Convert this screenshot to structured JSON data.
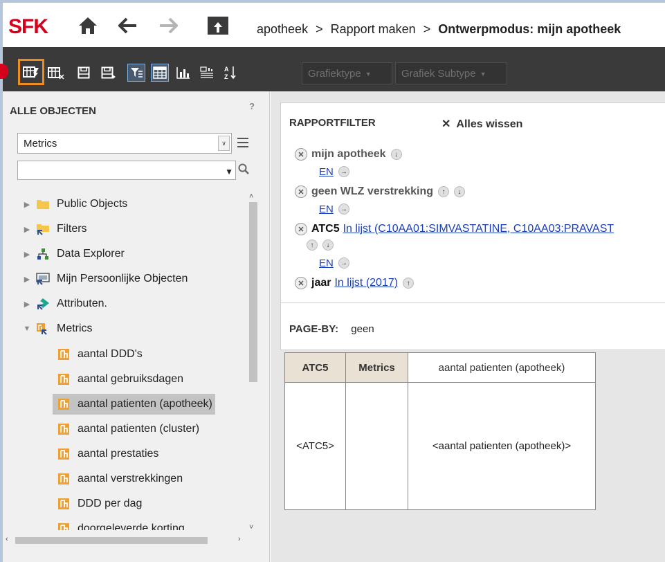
{
  "header": {
    "logo_text": "SFK",
    "breadcrumb": {
      "part1": "apotheek",
      "sep1": ">",
      "part2": "Rapport maken",
      "sep2": ">",
      "current": "Ontwerpmodus: mijn apotheek"
    },
    "icons": [
      "home-icon",
      "back-arrow-icon",
      "forward-arrow-icon",
      "upload-folder-icon"
    ]
  },
  "toolbar": {
    "grafiektype": "Grafiektype",
    "grafiek_subtype": "Grafiek Subtype",
    "accent_highlight": "#ef8a1c"
  },
  "left_panel": {
    "title": "ALLE OBJECTEN",
    "help": "?",
    "object_type_select": "Metrics",
    "search_value": "",
    "tree": [
      {
        "label": "Public Objects",
        "icon": "folder-icon"
      },
      {
        "label": "Filters",
        "icon": "filter-folder-icon"
      },
      {
        "label": "Data Explorer",
        "icon": "hierarchy-icon"
      },
      {
        "label": "Mijn Persoonlijke Objecten",
        "icon": "personal-objects-icon"
      },
      {
        "label": "Attributen.",
        "icon": "attribute-icon"
      },
      {
        "label": "Metrics",
        "icon": "metrics-folder-icon"
      },
      {
        "label": "aantal DDD's",
        "icon": "metric-icon"
      },
      {
        "label": "aantal gebruiksdagen",
        "icon": "metric-icon"
      },
      {
        "label": "aantal patienten (apotheek)",
        "icon": "metric-icon"
      },
      {
        "label": "aantal patienten (cluster)",
        "icon": "metric-icon"
      },
      {
        "label": "aantal prestaties",
        "icon": "metric-icon"
      },
      {
        "label": "aantal verstrekkingen",
        "icon": "metric-icon"
      },
      {
        "label": "DDD per dag",
        "icon": "metric-icon"
      },
      {
        "label": "doorgeleverde korting",
        "icon": "metric-icon"
      }
    ]
  },
  "report_filter": {
    "title": "RAPPORTFILTER",
    "clear_all": "Alles wissen",
    "filters": [
      {
        "name": "mijn apotheek",
        "link": ""
      },
      {
        "name": "geen WLZ verstrekking",
        "link": ""
      },
      {
        "name": "ATC5",
        "link": "In lijst  (C10AA01:SIMVASTATINE, C10AA03:PRAVAST"
      },
      {
        "name": "jaar",
        "link": "In lijst  (2017)"
      }
    ],
    "operator": "EN",
    "page_by_label": "PAGE-BY:",
    "page_by_value": "geen"
  },
  "grid": {
    "headers": [
      "ATC5",
      "Metrics",
      "aantal patienten (apotheek)"
    ],
    "row": [
      "<ATC5>",
      "",
      "<aantal patienten (apotheek)>"
    ]
  }
}
